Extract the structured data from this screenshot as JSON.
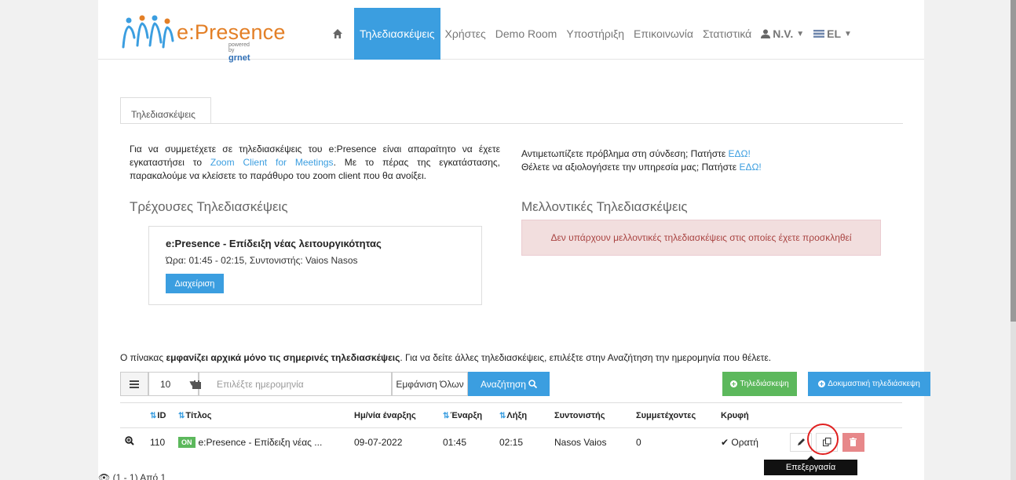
{
  "header": {
    "logo_text": "e:Presence",
    "logo_powered": "powered by",
    "logo_brand": "grnet",
    "nav": [
      {
        "label": "Τηλεδιασκέψεις"
      },
      {
        "label": "Χρήστες"
      },
      {
        "label": "Demo Room"
      },
      {
        "label": "Υποστήριξη"
      },
      {
        "label": "Επικοινωνία"
      },
      {
        "label": "Στατιστικά"
      }
    ],
    "user": "N.V.",
    "lang": "EL",
    "accent": "#3b9ee0"
  },
  "tab": {
    "label": "Τηλεδιασκέψεις"
  },
  "intro": {
    "part1": "Για να συμμετέχετε σε τηλεδιασκέψεις του e:Presence είναι απαραίτητο να έχετε εγκαταστήσει το ",
    "link": "Zoom Client for Meetings",
    "part2": ". Με το πέρας της εγκατάστασης, παρακαλούμε να κλείσετε το παράθυρο του zoom client που θα ανοίξει."
  },
  "help": {
    "line1": "Αντιμετωπίζετε πρόβλημα στη σύνδεση; Πατήστε ",
    "line1_link": "ΕΔΩ!",
    "line2": "Θέλετε να αξιολογήσετε την υπηρεσία μας; Πατήστε ",
    "line2_link": "ΕΔΩ!"
  },
  "current": {
    "heading": "Τρέχουσες Τηλεδιασκέψεις",
    "title": "e:Presence - Επίδειξη νέας λειτουργικότητας",
    "time": "Ώρα: 01:45 - 02:15, Συντονιστής: Vaios Nasos",
    "manage_label": "Διαχείριση"
  },
  "future": {
    "heading": "Μελλοντικές Τηλεδιασκέψεις",
    "alert": "Δεν υπάρχουν μελλοντικές τηλεδιασκέψεις στις οποίες έχετε προσκληθεί"
  },
  "table_note": {
    "prefix": "Ο πίνακας ",
    "bold": "εμφανίζει αρχικά μόνο τις σημερινές τηλεδιασκέψεις",
    "suffix": ". Για να δείτε άλλες τηλεδιασκέψεις, επιλέξτε στην Αναζήτηση την ημερομηνία που θέλετε."
  },
  "toolbar": {
    "page_size": "10",
    "date_placeholder": "Επιλέξτε ημερομηνία",
    "show_all": "Εμφάνιση Όλων",
    "search": "Αναζήτηση",
    "new_conf": "Τηλεδιάσκεψη",
    "test_conf": "Δοκιμαστική τηλεδιάσκεψη"
  },
  "table": {
    "headers": {
      "id": "ID",
      "title": "Τίτλος",
      "start_date": "Ημ/νία έναρξης",
      "start": "Έναρξη",
      "end": "Λήξη",
      "moderator": "Συντονιστής",
      "participants": "Συμμετέχοντες",
      "hidden": "Κρυφή"
    },
    "rows": [
      {
        "id": "110",
        "badge": "ON",
        "title": "e:Presence - Επίδειξη νέας ...",
        "start_date": "09-07-2022",
        "start": "01:45",
        "end": "02:15",
        "moderator": "Nasos Vaios",
        "participants": "0",
        "visibility": "Ορατή"
      }
    ]
  },
  "tooltip": "Επεξεργασία",
  "pagination": "(1 - 1) Από 1"
}
